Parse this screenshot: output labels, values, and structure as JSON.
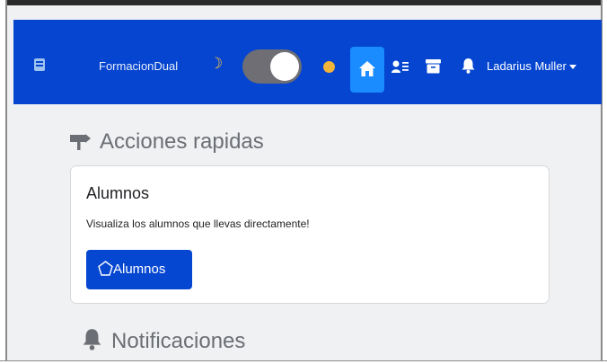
{
  "navbar": {
    "brand": "FormacionDual",
    "theme_toggle_state": "dark-mode-off",
    "user_name": "Ladarius Muller",
    "icons": [
      "logo-icon",
      "moon-icon",
      "sun-icon",
      "home-icon",
      "user-list-icon",
      "archive-icon",
      "bell-icon",
      "caret-down-icon"
    ]
  },
  "main": {
    "quick_actions_title": "Acciones rapidas",
    "card": {
      "title": "Alumnos",
      "text": "Visualiza los alumnos que llevas directamente!",
      "button_label": "Alumnos"
    },
    "notifications_title": "Notificaciones"
  },
  "colors": {
    "navbar_bg": "#0545d0",
    "active_nav": "#1a8cff",
    "primary_button": "#0647d1",
    "page_bg": "#f0f1f3"
  }
}
